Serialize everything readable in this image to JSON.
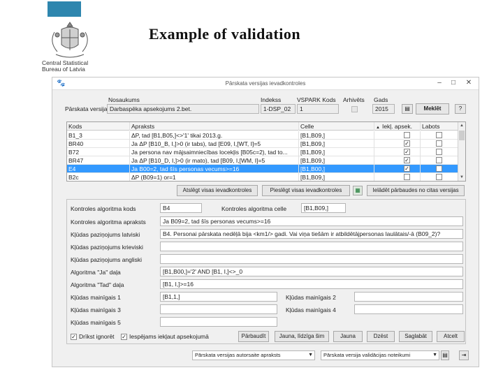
{
  "slide": {
    "title": "Example of validation",
    "org_line1": "Central Statistical",
    "org_line2": "Bureau of Latvia"
  },
  "window": {
    "title": "Pārskata versijas ievadkontroles",
    "minimize": "–",
    "maximize": "□",
    "close": "✕"
  },
  "header": {
    "version_label": "Pārskata versija:",
    "name_label": "Nosaukums",
    "index_label": "Indekss",
    "code_label": "VSPARK Kods",
    "archive_label": "Arhivēts",
    "year_label": "Gads",
    "name_value": "Darbaspēka apsekojums 2.bet.",
    "index_value": "1-DSP_02",
    "code_value": "1",
    "year_value": "2015",
    "select_button": "Meklēt"
  },
  "grid": {
    "columns": [
      "Kods",
      "Apraksts",
      "Celle",
      "Iekļ. apsek.",
      "Labots"
    ],
    "rows": [
      {
        "code": "B1_3",
        "desc": "ΔP, tad [B1,B05,]<>'1'    tikai 2013.g.",
        "cell": "[B1,B09,]",
        "incl": false,
        "fixed": false
      },
      {
        "code": "BR40",
        "desc": "Ja ΔP [B10_B, I,]>0 (ir tabs), tad [E09, I,[WT, I]=5",
        "cell": "[B1,B09,]",
        "incl": true,
        "fixed": false
      },
      {
        "code": "B72",
        "desc": "Ja persona nav mājsaimniecības locekļis [B05c=2), tad to...",
        "cell": "[B1,B09,]",
        "incl": true,
        "fixed": false
      },
      {
        "code": "BR47",
        "desc": "Ja ΔP [B10_D, I,]>0 (ir mato), tad [B09, I,[WM, I]=5",
        "cell": "[B1,B09,]",
        "incl": true,
        "fixed": false
      },
      {
        "code": "E4",
        "desc": "Ja B00=2, tad šīs personas vecums>=16",
        "cell": "[B1,B00,]",
        "incl": true,
        "fixed": false,
        "selected": true
      },
      {
        "code": "B2c",
        "desc": "ΔP (B09=1) or=1",
        "cell": "[B1,B09,]",
        "incl": false,
        "fixed": false
      }
    ]
  },
  "toolbar": {
    "deselect_all": "Atslēgt visas ievadkontroles",
    "activate_selected": "Pieslēgt visas ievadkontroles",
    "copy_other": "Ielādēt pārbaudes no citas versijas"
  },
  "form": {
    "algorithm_code_label": "Kontroles algoritma kods",
    "algorithm_code_value": "B4",
    "algorithm_cell_label": "Kontroles algoritma celle",
    "algorithm_cell_value": "[B1,B09,]",
    "algorithm_desc_label": "Kontroles algoritma apraksts",
    "algorithm_desc_value": "Ja B09=2, tad šīs personas vecums>=16",
    "error_lv_label": "Kļūdas paziņojums latviski",
    "error_lv_value": "B4. Personai pārskata nedēļā bija <km1/> gadi. Vai viņa tiešām ir atbildētājpersonas laulātais/-ā (B09_2)?",
    "error_ru_label": "Kļūdas paziņojums krieviski",
    "error_ru_value": "",
    "error_en_label": "Kļūdas paziņojums angliski",
    "error_en_value": "",
    "if_label": "Algoritma \"Ja\" daļa",
    "if_value": "[B1,B00,]='2' AND [B1, I,]<>_0",
    "then_label": "Algoritma \"Tad\" daļa",
    "then_value": "[B1, I,]>=16",
    "var1_label": "Kļūdas mainīgais 1",
    "var1_value": "[B1,1,]",
    "var2_label": "Kļūdas mainīgais 2",
    "var2_value": "",
    "var3_label": "Kļūdas mainīgais 3",
    "var3_value": "",
    "var4_label": "Kļūdas mainīgais 4",
    "var4_value": "",
    "var5_label": "Kļūdas mainīgais 5",
    "var5_value": "",
    "ignore_label": "Drīkst ignorēt",
    "include_label": "Iespējams iekļaut apsekojumā"
  },
  "actions": {
    "check": "Pārbaudīt",
    "new_like": "Jauna, līdzīga šim",
    "new": "Jauna",
    "delete": "Dzēst",
    "save": "Saglabāt",
    "cancel": "Atcelt"
  },
  "footer": {
    "select1": "Pārskata versijas autorsaite apraksts",
    "select2": "Pārskata versija validācijas noteikumi"
  }
}
